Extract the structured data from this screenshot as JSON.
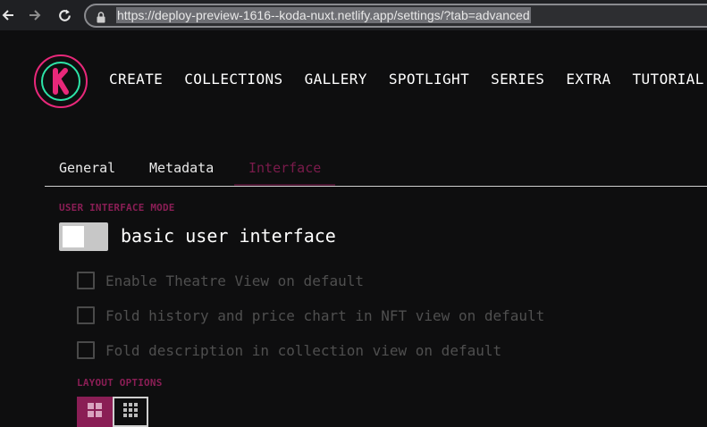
{
  "browser": {
    "url": "https://deploy-preview-1616--koda-nuxt.netlify.app/settings/?tab=advanced",
    "icons": [
      "back-arrow-icon",
      "forward-arrow-icon",
      "reload-icon",
      "lock-icon"
    ]
  },
  "header": {
    "logo_letter": "K",
    "nav": [
      "CREATE",
      "COLLECTIONS",
      "GALLERY",
      "SPOTLIGHT",
      "SERIES",
      "EXTRA",
      "TUTORIAL"
    ]
  },
  "tabs": [
    "General",
    "Metadata",
    "Interface"
  ],
  "active_tab": "Interface",
  "settings": {
    "ui_mode_label": "USER INTERFACE MODE",
    "toggle_label": "basic user interface",
    "toggle_on": false,
    "options": [
      "Enable Theatre View on default",
      "Fold history and price chart in NFT view on default",
      "Fold description in collection view on default"
    ],
    "layout_label": "LAYOUT OPTIONS",
    "layout_icons": [
      "grid-2x2-icon",
      "grid-3x3-icon"
    ]
  },
  "colors": {
    "accent": "#8a1e55",
    "logo_ring": "#e8287a",
    "logo_inner": "#2de4a8"
  }
}
